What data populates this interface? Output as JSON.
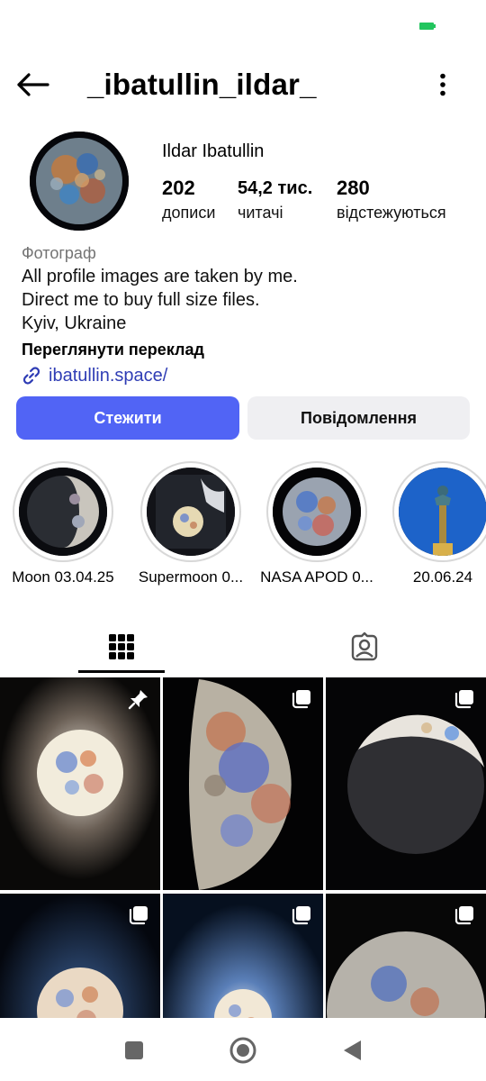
{
  "top_bar": {
    "username": "_ibatullin_ildar_",
    "back_icon": "arrow-left-icon",
    "more_icon": "more-vertical-icon"
  },
  "profile": {
    "display_name": "Ildar Ibatullin",
    "stats": [
      {
        "value": "202",
        "label": "дописи"
      },
      {
        "value": "54,2 тис.",
        "label": "читачі"
      },
      {
        "value": "280",
        "label": "відстежуються"
      }
    ],
    "category": "Фотограф",
    "bio_lines": [
      "All profile images are taken by me.",
      "Direct me to buy full size files.",
      "Kyiv, Ukraine"
    ],
    "translate_label": "Переглянути переклад",
    "link": "ibatullin.space/"
  },
  "buttons": {
    "follow": "Стежити",
    "message": "Повідомлення"
  },
  "stories": [
    {
      "caption": "Moon 03.04.25"
    },
    {
      "caption": "Supermoon 0..."
    },
    {
      "caption": "NASA APOD 0..."
    },
    {
      "caption": "20.06.24"
    }
  ],
  "tabs": [
    {
      "icon": "grid-icon"
    },
    {
      "icon": "tagged-user-icon"
    }
  ],
  "grid": {
    "items": [
      {
        "badge": "pin-icon"
      },
      {
        "badge": "carousel-icon"
      },
      {
        "badge": "carousel-icon"
      },
      {
        "badge": "carousel-icon"
      },
      {
        "badge": "carousel-icon"
      },
      {
        "badge": "carousel-icon"
      }
    ]
  },
  "colors": {
    "accent": "#5164f5",
    "secondary_button": "#efeff2",
    "link": "#2f3db5",
    "battery": "#22c55e"
  }
}
